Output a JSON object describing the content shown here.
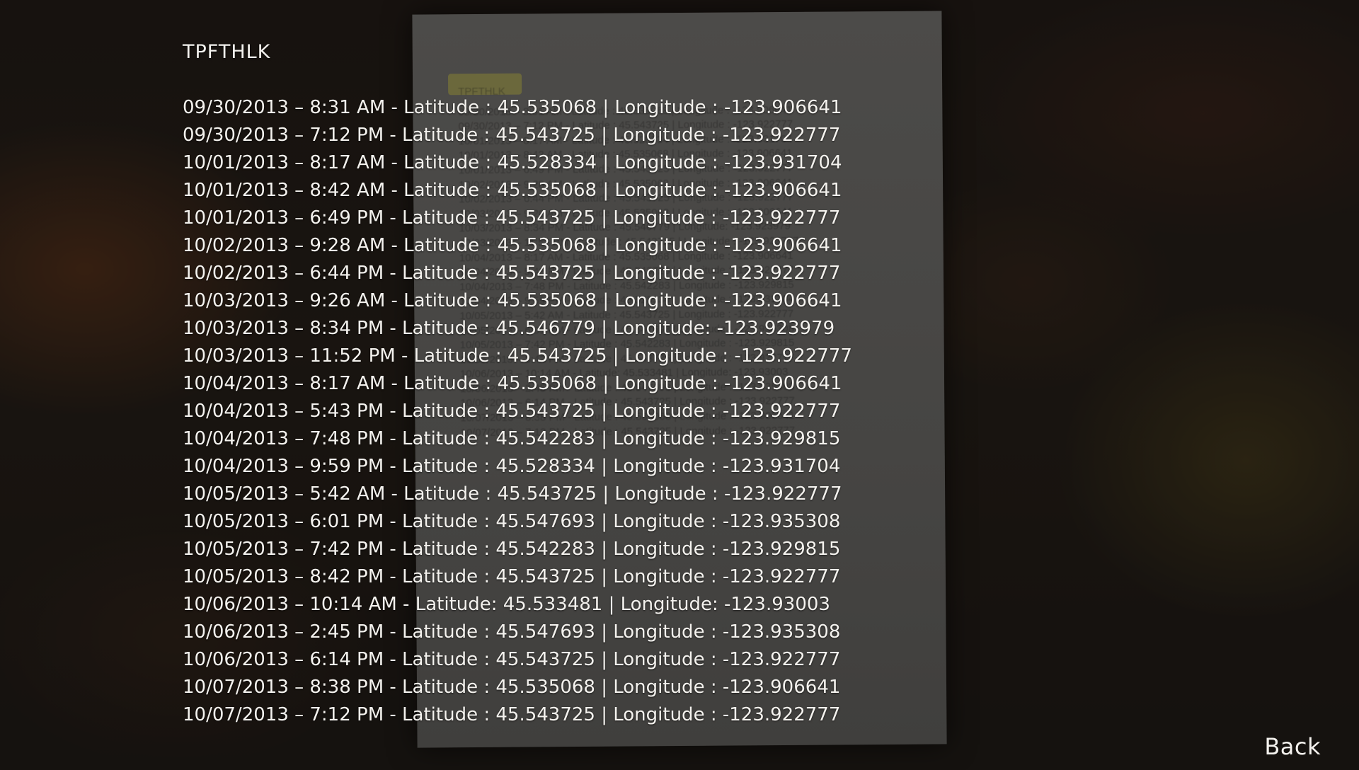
{
  "document": {
    "title": "TPFTHLK",
    "entries": [
      "09/30/2013 – 8:31 AM - Latitude : 45.535068 | Longitude : -123.906641",
      "09/30/2013 – 7:12 PM - Latitude : 45.543725 | Longitude : -123.922777",
      "10/01/2013 – 8:17 AM - Latitude : 45.528334 | Longitude : -123.931704",
      "10/01/2013 – 8:42 AM - Latitude : 45.535068 | Longitude : -123.906641",
      "10/01/2013 – 6:49 PM - Latitude : 45.543725 | Longitude : -123.922777",
      "10/02/2013 – 9:28 AM - Latitude : 45.535068 | Longitude : -123.906641",
      "10/02/2013 – 6:44 PM - Latitude : 45.543725 | Longitude : -123.922777",
      "10/03/2013 – 9:26 AM - Latitude : 45.535068 | Longitude : -123.906641",
      "10/03/2013 – 8:34 PM - Latitude : 45.546779 | Longitude: -123.923979",
      "10/03/2013 – 11:52 PM - Latitude : 45.543725 | Longitude : -123.922777",
      "10/04/2013 – 8:17 AM - Latitude : 45.535068 | Longitude : -123.906641",
      "10/04/2013 – 5:43 PM - Latitude : 45.543725 | Longitude : -123.922777",
      "10/04/2013 – 7:48 PM - Latitude : 45.542283 | Longitude : -123.929815",
      "10/04/2013 – 9:59 PM - Latitude : 45.528334 | Longitude : -123.931704",
      "10/05/2013 – 5:42 AM - Latitude : 45.543725 | Longitude : -123.922777",
      "10/05/2013 – 6:01 PM - Latitude : 45.547693 | Longitude : -123.935308",
      "10/05/2013 – 7:42 PM - Latitude : 45.542283 | Longitude : -123.929815",
      "10/05/2013 – 8:42 PM - Latitude : 45.543725 | Longitude : -123.922777",
      "10/06/2013 – 10:14 AM - Latitude: 45.533481 | Longitude: -123.93003",
      "10/06/2013 – 2:45 PM - Latitude : 45.547693 | Longitude : -123.935308",
      "10/06/2013 – 6:14 PM - Latitude : 45.543725 | Longitude : -123.922777",
      "10/07/2013 – 8:38 PM - Latitude : 45.535068 | Longitude : -123.906641",
      "10/07/2013 – 7:12 PM - Latitude : 45.543725 | Longitude : -123.922777"
    ]
  },
  "back_label": "Back",
  "colors": {
    "overlay_text": "#f4f2ee",
    "paper": "#4a4947"
  }
}
